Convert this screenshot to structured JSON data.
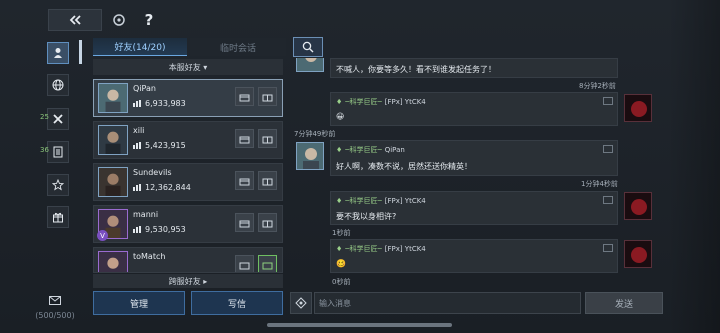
{
  "topbar": {
    "help_label": "?"
  },
  "rail": {
    "items": [
      {
        "name": "profile"
      },
      {
        "name": "globe"
      },
      {
        "name": "guild",
        "count": "25"
      },
      {
        "name": "notes",
        "count": "36"
      },
      {
        "name": "favorites"
      },
      {
        "name": "gift"
      }
    ],
    "mail_count": "(500/500)"
  },
  "tabs": {
    "friends": "好友(14/20)",
    "temp": "临时会话"
  },
  "list": {
    "header": "本服好友 ▾",
    "footer": "跨服好友 ▸",
    "friends": [
      {
        "name": "QiPan",
        "power": "6,933,983",
        "selected": true
      },
      {
        "name": "xili",
        "power": "5,423,915"
      },
      {
        "name": "Sundevils",
        "power": "12,362,844"
      },
      {
        "name": "manni",
        "power": "9,530,953",
        "vip": "V"
      },
      {
        "name": "toMatch",
        "power": ""
      }
    ],
    "manage_label": "管理",
    "write_label": "写信"
  },
  "chat": {
    "messages": [
      {
        "text": "不喊人，你要等多久！看不到谁发起任务了！"
      },
      {
        "time": "8分钟2秒前"
      },
      {
        "sender_tag": "─科学巨匠─",
        "sender_name": "[FPx] YtCK4",
        "text": ""
      },
      {
        "time": "7分钟49秒前"
      },
      {
        "sender_tag": "─科学巨匠─",
        "sender_name": "QiPan",
        "text": "好人啊，凑数不说，居然还送你精英！"
      },
      {
        "time": "1分钟4秒前"
      },
      {
        "sender_tag": "─科学巨匠─",
        "sender_name": "[FPx] YtCK4",
        "text": "要不我以身相许?"
      },
      {
        "time": "1秒前"
      },
      {
        "sender_tag": "─科学巨匠─",
        "sender_name": "[FPx] YtCK4",
        "text": ""
      },
      {
        "time": "0秒前"
      }
    ]
  },
  "input": {
    "placeholder": "输入消息",
    "send_label": "发送"
  }
}
